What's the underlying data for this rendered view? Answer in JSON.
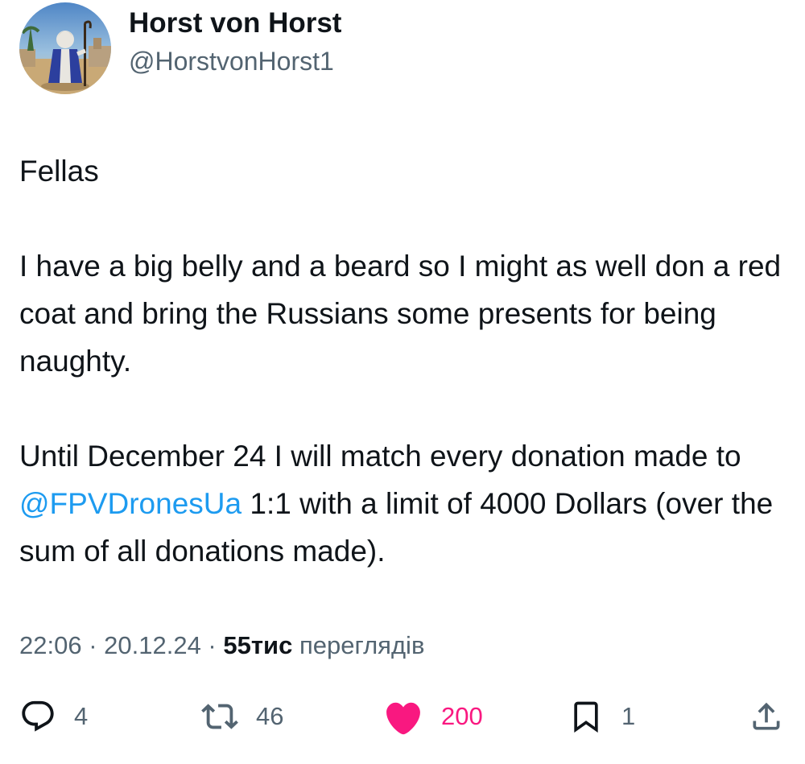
{
  "author": {
    "display_name": "Horst von Horst",
    "handle": "@HorstvonHorst1",
    "avatar_icon": "profile-avatar"
  },
  "tweet": {
    "paragraph1": "Fellas",
    "paragraph2": "I have a big belly and a beard so I might as well don a red coat and bring the Russians some presents for being naughty.",
    "paragraph3_before_mention": "Until December 24 I will match every donation made to ",
    "mention": "@FPVDronesUa",
    "paragraph3_after_mention": " 1:1 with a limit of 4000 Dollars (over the sum of all donations made)."
  },
  "meta": {
    "time": "22:06",
    "separator1": " · ",
    "date": "20.12.24",
    "separator2": " · ",
    "views_count": "55тис",
    "views_label": " переглядів"
  },
  "actions": {
    "reply_count": "4",
    "repost_count": "46",
    "like_count": "200",
    "bookmark_count": "1",
    "reply_icon": "reply-icon",
    "repost_icon": "repost-icon",
    "like_icon": "heart-icon",
    "bookmark_icon": "bookmark-icon",
    "share_icon": "share-icon"
  },
  "colors": {
    "text": "#0f1419",
    "secondary": "#536471",
    "link": "#1d9bf0",
    "like": "#f91880"
  }
}
